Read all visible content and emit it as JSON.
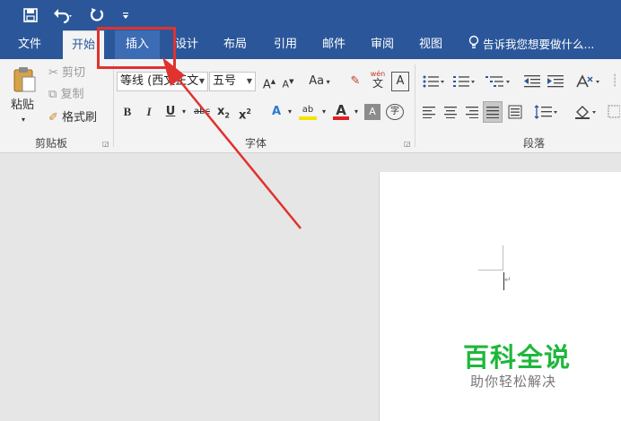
{
  "qat": {
    "save_icon": "save-icon",
    "undo_icon": "undo-icon",
    "redo_icon": "redo-icon",
    "customize_icon": "customize-qat-icon"
  },
  "tabs": [
    {
      "label": "文件"
    },
    {
      "label": "开始"
    },
    {
      "label": "插入"
    },
    {
      "label": "设计"
    },
    {
      "label": "布局"
    },
    {
      "label": "引用"
    },
    {
      "label": "邮件"
    },
    {
      "label": "审阅"
    },
    {
      "label": "视图"
    }
  ],
  "tell_me": "告诉我您想要做什么...",
  "clipboard": {
    "paste": "粘贴",
    "cut": "剪切",
    "copy": "复制",
    "format_painter": "格式刷",
    "group_label": "剪贴板"
  },
  "font": {
    "font_name": "等线 (西文正文",
    "font_size": "五号",
    "grow": "A",
    "shrink": "A",
    "change_case": "Aa",
    "phonetic_top": "wén",
    "phonetic_bottom": "文",
    "border_char": "A",
    "bold": "B",
    "italic": "I",
    "underline": "U",
    "strike": "abc",
    "subscript": "x",
    "subscript_mark": "2",
    "superscript": "x",
    "superscript_mark": "2",
    "text_effects": "A",
    "highlight": "ab",
    "font_color": "A",
    "char_shading": "A",
    "enclose": "字",
    "group_label": "字体"
  },
  "paragraph": {
    "group_label": "段落"
  },
  "watermark": {
    "title": "百科全说",
    "subtitle": "助你轻松解决"
  },
  "document": {
    "paragraph_mark": "↵"
  },
  "colors": {
    "brand": "#2b579a",
    "highlight_box": "#e0322f",
    "watermark_green": "#1fb73b",
    "font_color_bar": "#e02020",
    "highlight_bar": "#f5e400"
  }
}
